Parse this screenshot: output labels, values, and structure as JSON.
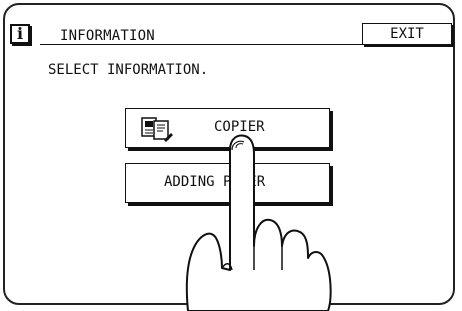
{
  "header": {
    "icon": "info-icon",
    "icon_glyph": "i",
    "title": "INFORMATION",
    "exit_label": "EXIT"
  },
  "instruction": "SELECT INFORMATION.",
  "menu": {
    "items": [
      {
        "label": "COPIER",
        "icon": "copier-icon"
      },
      {
        "label": "ADDING PAPER",
        "icon": null
      }
    ]
  },
  "overlay": {
    "icon": "pointing-hand-icon"
  }
}
